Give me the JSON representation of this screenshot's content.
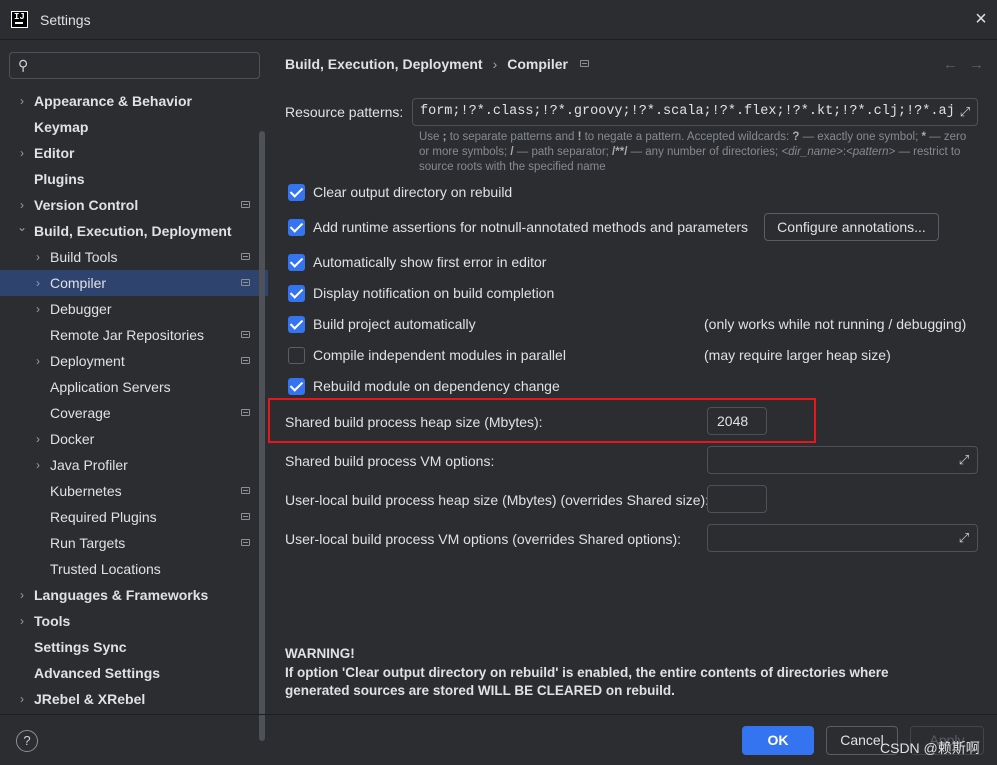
{
  "window": {
    "title": "Settings",
    "app_icon_text": "IJ"
  },
  "search": {
    "placeholder": "",
    "icon": "search-icon",
    "value": ""
  },
  "sidebar": {
    "items": [
      {
        "label": "Appearance & Behavior",
        "bold": true,
        "expandable": true,
        "indent": 0,
        "project": false,
        "selected": false
      },
      {
        "label": "Keymap",
        "bold": true,
        "expandable": false,
        "indent": 0,
        "project": false,
        "selected": false
      },
      {
        "label": "Editor",
        "bold": true,
        "expandable": true,
        "indent": 0,
        "project": false,
        "selected": false
      },
      {
        "label": "Plugins",
        "bold": true,
        "expandable": false,
        "indent": 0,
        "project": false,
        "selected": false
      },
      {
        "label": "Version Control",
        "bold": true,
        "expandable": true,
        "indent": 0,
        "project": true,
        "selected": false
      },
      {
        "label": "Build, Execution, Deployment",
        "bold": true,
        "expandable": true,
        "expanded": true,
        "indent": 0,
        "project": false,
        "selected": false
      },
      {
        "label": "Build Tools",
        "bold": false,
        "expandable": true,
        "indent": 1,
        "project": true,
        "selected": false
      },
      {
        "label": "Compiler",
        "bold": false,
        "expandable": true,
        "indent": 1,
        "project": true,
        "selected": true
      },
      {
        "label": "Debugger",
        "bold": false,
        "expandable": true,
        "indent": 1,
        "project": false,
        "selected": false
      },
      {
        "label": "Remote Jar Repositories",
        "bold": false,
        "expandable": false,
        "indent": 1,
        "project": true,
        "selected": false
      },
      {
        "label": "Deployment",
        "bold": false,
        "expandable": true,
        "indent": 1,
        "project": true,
        "selected": false
      },
      {
        "label": "Application Servers",
        "bold": false,
        "expandable": false,
        "indent": 1,
        "project": false,
        "selected": false
      },
      {
        "label": "Coverage",
        "bold": false,
        "expandable": false,
        "indent": 1,
        "project": true,
        "selected": false
      },
      {
        "label": "Docker",
        "bold": false,
        "expandable": true,
        "indent": 1,
        "project": false,
        "selected": false
      },
      {
        "label": "Java Profiler",
        "bold": false,
        "expandable": true,
        "indent": 1,
        "project": false,
        "selected": false
      },
      {
        "label": "Kubernetes",
        "bold": false,
        "expandable": false,
        "indent": 1,
        "project": true,
        "selected": false
      },
      {
        "label": "Required Plugins",
        "bold": false,
        "expandable": false,
        "indent": 1,
        "project": true,
        "selected": false
      },
      {
        "label": "Run Targets",
        "bold": false,
        "expandable": false,
        "indent": 1,
        "project": true,
        "selected": false
      },
      {
        "label": "Trusted Locations",
        "bold": false,
        "expandable": false,
        "indent": 1,
        "project": false,
        "selected": false
      },
      {
        "label": "Languages & Frameworks",
        "bold": true,
        "expandable": true,
        "indent": 0,
        "project": false,
        "selected": false
      },
      {
        "label": "Tools",
        "bold": true,
        "expandable": true,
        "indent": 0,
        "project": false,
        "selected": false
      },
      {
        "label": "Settings Sync",
        "bold": true,
        "expandable": false,
        "indent": 0,
        "project": false,
        "selected": false
      },
      {
        "label": "Advanced Settings",
        "bold": true,
        "expandable": false,
        "indent": 0,
        "project": false,
        "selected": false
      },
      {
        "label": "JRebel & XRebel",
        "bold": true,
        "expandable": true,
        "indent": 0,
        "project": false,
        "selected": false
      }
    ]
  },
  "breadcrumb": {
    "parent": "Build, Execution, Deployment",
    "separator": "›",
    "current": "Compiler",
    "back": "←",
    "forward": "→"
  },
  "resource_patterns": {
    "label": "Resource patterns:",
    "value": "form;!?*.class;!?*.groovy;!?*.scala;!?*.flex;!?*.kt;!?*.clj;!?*.aj",
    "hint_1": "Use ",
    "hint_semicolon": ";",
    "hint_2": " to separate patterns and ",
    "hint_bang": "!",
    "hint_3": " to negate a pattern. Accepted wildcards: ",
    "hint_q": "?",
    "hint_4": " — exactly one symbol; ",
    "hint_star": "*",
    "hint_5": " — zero or more symbols; ",
    "hint_slash": "/",
    "hint_6": " — path separator; ",
    "hint_dstar": "/**/",
    "hint_7": " — any number of directories; ",
    "hint_dirname": "<dir_name>",
    "hint_8": ":",
    "hint_pattern": "<pattern>",
    "hint_9": " — restrict to source roots with the specified name"
  },
  "checkboxes": [
    {
      "label": "Clear output directory on rebuild",
      "checked": true,
      "note": ""
    },
    {
      "label": "Add runtime assertions for notnull-annotated methods and parameters",
      "checked": true,
      "note": ""
    },
    {
      "label": "Automatically show first error in editor",
      "checked": true,
      "note": ""
    },
    {
      "label": "Display notification on build completion",
      "checked": true,
      "note": ""
    },
    {
      "label": "Build project automatically",
      "checked": true,
      "note": "(only works while not running / debugging)"
    },
    {
      "label": "Compile independent modules in parallel",
      "checked": false,
      "note": "(may require larger heap size)"
    },
    {
      "label": "Rebuild module on dependency change",
      "checked": true,
      "note": ""
    }
  ],
  "configure_annotations_button": "Configure annotations...",
  "fields": {
    "heap_label": "Shared build process heap size (Mbytes):",
    "heap_value": "2048",
    "vm_label": "Shared build process VM options:",
    "vm_value": "",
    "user_heap_label": "User-local build process heap size (Mbytes) (overrides Shared size):",
    "user_heap_value": "",
    "user_vm_label": "User-local build process VM options (overrides Shared options):",
    "user_vm_value": ""
  },
  "warning": {
    "title": "WARNING!",
    "line1": "If option 'Clear output directory on rebuild' is enabled, the entire contents of directories where",
    "line2": "generated sources are stored WILL BE CLEARED on rebuild."
  },
  "footer": {
    "help": "?",
    "ok": "OK",
    "cancel": "Cancel",
    "apply": "Apply"
  },
  "watermark": "CSDN @赖斯啊",
  "colors": {
    "accent": "#3574f0",
    "highlight_border": "#e8161b",
    "background": "#2b2d30",
    "selected": "#2e436e"
  }
}
